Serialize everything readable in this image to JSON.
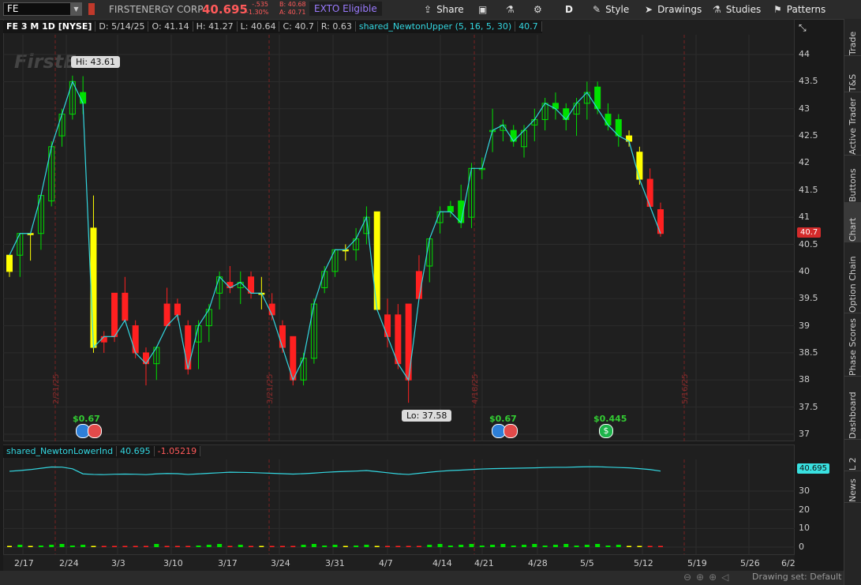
{
  "toolbar": {
    "symbol": "FE",
    "company": "FIRSTENERGY CORP",
    "last": "40.695",
    "change": "-.535",
    "change_pct": "-1.30%",
    "bid": "B: 40.68",
    "ask": "A: 40.71",
    "exto": "EXTO Eligible",
    "share": "Share",
    "aggregation": "D",
    "style": "Style",
    "drawings": "Drawings",
    "studies": "Studies",
    "patterns": "Patterns"
  },
  "infobar": {
    "symbol": "FE 3 M 1D [NYSE]",
    "date": "D: 5/14/25",
    "open": "O: 41.14",
    "high": "H: 41.27",
    "low": "L: 40.64",
    "close": "C: 40.7",
    "range": "R: 0.63",
    "study": "shared_NewtonUpper (5, 16, 5, 30)",
    "study_value": "40.7"
  },
  "lower": {
    "study": "shared_NewtonLowerInd",
    "value": "40.695",
    "value2": "-1.05219",
    "tag": "40.695"
  },
  "price_tag": "40.7",
  "callouts": {
    "hi": "Hi: 43.61",
    "lo": "Lo: 37.58"
  },
  "logo": "FirstE",
  "dividends": [
    "$0.67",
    "$0.67",
    "$0.445"
  ],
  "vlines": [
    "2/21/25",
    "3/21/25",
    "4/18/25",
    "5/16/25"
  ],
  "price_axis": [
    "44",
    "43.5",
    "43",
    "42.5",
    "42",
    "41.5",
    "41",
    "40.5",
    "40",
    "39.5",
    "39",
    "38.5",
    "38",
    "37.5",
    "37"
  ],
  "lower_axis": [
    "30",
    "20",
    "10",
    "0"
  ],
  "x_axis": [
    "2/17",
    "2/24",
    "3/3",
    "3/10",
    "3/17",
    "3/24",
    "3/31",
    "4/7",
    "4/14",
    "4/21",
    "4/28",
    "5/5",
    "5/12",
    "5/19",
    "5/26",
    "6/2"
  ],
  "sidebar": [
    "Trade",
    "T&S",
    "Active Trader",
    "Buttons",
    "Chart",
    "Option Chain",
    "Phase Scores",
    "Dashboard",
    "L 2",
    "News"
  ],
  "drawing_set": "Drawing set: Default",
  "colors": {
    "up": "#00e000",
    "down": "#ff2020",
    "neutral": "#ffff00",
    "line": "#33d6e0",
    "grid": "#2c2c2c",
    "vline": "#7a2020"
  },
  "chart_data": {
    "type": "candlestick",
    "ylim": [
      36.8,
      44.3
    ],
    "candles": [
      [
        "2/14",
        40.0,
        40.3,
        39.9,
        40.3,
        "y"
      ],
      [
        "2/18",
        40.3,
        40.7,
        39.9,
        40.7,
        "g"
      ],
      [
        "2/19",
        40.7,
        40.7,
        40.2,
        40.7,
        "y"
      ],
      [
        "2/20",
        40.7,
        41.4,
        40.4,
        41.4,
        "g"
      ],
      [
        "2/21",
        41.3,
        42.4,
        41.2,
        42.3,
        "g"
      ],
      [
        "2/24",
        42.5,
        43.0,
        42.3,
        42.9,
        "g"
      ],
      [
        "2/25",
        42.9,
        43.61,
        42.8,
        43.5,
        "g"
      ],
      [
        "2/26",
        43.3,
        43.6,
        42.9,
        43.1,
        "g"
      ],
      [
        "2/27",
        40.8,
        41.4,
        38.5,
        38.6,
        "y"
      ],
      [
        "2/28",
        38.7,
        38.9,
        38.5,
        38.8,
        "r"
      ],
      [
        "3/3",
        39.6,
        39.6,
        38.7,
        38.8,
        "r"
      ],
      [
        "3/4",
        39.6,
        39.9,
        39.1,
        39.1,
        "r"
      ],
      [
        "3/5",
        39.0,
        39.1,
        38.4,
        38.5,
        "r"
      ],
      [
        "3/6",
        38.5,
        38.6,
        37.9,
        38.3,
        "r"
      ],
      [
        "3/7",
        38.3,
        38.6,
        38.0,
        38.6,
        "g"
      ],
      [
        "3/10",
        39.4,
        39.7,
        39.0,
        39.0,
        "r"
      ],
      [
        "3/11",
        39.4,
        39.5,
        39.1,
        39.2,
        "r"
      ],
      [
        "3/12",
        39.0,
        39.1,
        38.1,
        38.2,
        "r"
      ],
      [
        "3/13",
        38.7,
        39.1,
        38.2,
        39.0,
        "g"
      ],
      [
        "3/14",
        39.0,
        39.4,
        38.7,
        39.3,
        "g"
      ],
      [
        "3/17",
        39.6,
        40.0,
        39.3,
        39.9,
        "g"
      ],
      [
        "3/18",
        39.8,
        40.1,
        39.6,
        39.7,
        "r"
      ],
      [
        "3/19",
        39.7,
        40.0,
        39.4,
        39.8,
        "g"
      ],
      [
        "3/20",
        39.9,
        40.0,
        39.5,
        39.6,
        "r"
      ],
      [
        "3/21",
        39.6,
        39.9,
        39.3,
        39.6,
        "y"
      ],
      [
        "3/24",
        39.4,
        39.6,
        39.1,
        39.2,
        "r"
      ],
      [
        "3/25",
        39.0,
        39.1,
        38.5,
        38.6,
        "r"
      ],
      [
        "3/26",
        38.8,
        38.8,
        37.9,
        38.0,
        "r"
      ],
      [
        "3/27",
        38.0,
        38.5,
        37.9,
        38.4,
        "g"
      ],
      [
        "3/28",
        38.4,
        39.5,
        38.3,
        39.4,
        "g"
      ],
      [
        "3/31",
        39.7,
        40.1,
        39.6,
        40.0,
        "g"
      ],
      [
        "4/1",
        40.0,
        40.4,
        39.9,
        40.4,
        "g"
      ],
      [
        "4/2",
        40.4,
        40.5,
        40.2,
        40.4,
        "y"
      ],
      [
        "4/3",
        40.4,
        40.8,
        40.2,
        40.6,
        "g"
      ],
      [
        "4/4",
        40.7,
        41.2,
        40.5,
        41.0,
        "g"
      ],
      [
        "4/7",
        41.1,
        41.1,
        39.3,
        39.3,
        "y"
      ],
      [
        "4/8",
        39.2,
        39.5,
        38.6,
        38.8,
        "r"
      ],
      [
        "4/9",
        39.2,
        39.4,
        38.2,
        38.3,
        "r"
      ],
      [
        "4/10",
        39.4,
        39.4,
        37.58,
        38.0,
        "r"
      ],
      [
        "4/11",
        40.0,
        40.3,
        39.5,
        39.5,
        "r"
      ],
      [
        "4/14",
        40.1,
        40.6,
        39.8,
        40.6,
        "g"
      ],
      [
        "4/15",
        40.9,
        41.2,
        40.7,
        41.1,
        "g"
      ],
      [
        "4/16",
        41.2,
        41.3,
        41.0,
        41.1,
        "g"
      ],
      [
        "4/17",
        41.3,
        41.6,
        40.8,
        40.9,
        "g"
      ],
      [
        "4/21",
        41.0,
        42.0,
        40.8,
        41.9,
        "g"
      ],
      [
        "4/22",
        41.9,
        42.1,
        41.7,
        41.9,
        "g"
      ],
      [
        "4/23",
        42.6,
        43.0,
        42.2,
        42.6,
        "g"
      ],
      [
        "4/24",
        42.6,
        42.8,
        42.4,
        42.7,
        "g"
      ],
      [
        "4/25",
        42.6,
        42.7,
        42.3,
        42.4,
        "g"
      ],
      [
        "4/28",
        42.3,
        42.7,
        42.1,
        42.6,
        "g"
      ],
      [
        "4/29",
        42.7,
        43.0,
        42.4,
        42.8,
        "g"
      ],
      [
        "4/30",
        42.8,
        43.2,
        42.6,
        43.1,
        "g"
      ],
      [
        "5/1",
        43.1,
        43.3,
        42.8,
        43.0,
        "g"
      ],
      [
        "5/2",
        43.0,
        43.1,
        42.6,
        42.8,
        "g"
      ],
      [
        "5/5",
        42.9,
        43.2,
        42.5,
        43.1,
        "g"
      ],
      [
        "5/6",
        43.1,
        43.5,
        42.8,
        43.3,
        "g"
      ],
      [
        "5/7",
        43.4,
        43.5,
        42.9,
        43.0,
        "g"
      ],
      [
        "5/8",
        42.9,
        43.1,
        42.6,
        42.7,
        "g"
      ],
      [
        "5/9",
        42.8,
        42.9,
        42.3,
        42.5,
        "g"
      ],
      [
        "5/12",
        42.5,
        42.6,
        42.3,
        42.4,
        "y"
      ],
      [
        "5/13",
        42.2,
        42.3,
        41.6,
        41.7,
        "y"
      ],
      [
        "5/14",
        41.7,
        41.9,
        41.2,
        41.2,
        "r"
      ],
      [
        "5/15",
        41.14,
        41.27,
        40.64,
        40.7,
        "r"
      ]
    ],
    "lower_values": [
      40.6,
      41.0,
      41.5,
      42.2,
      42.9,
      42.8,
      41.9,
      39.2,
      38.9,
      38.8,
      39.0,
      39.1,
      39.0,
      38.8,
      39.2,
      39.4,
      39.3,
      38.9,
      39.2,
      39.5,
      39.8,
      40.1,
      40.0,
      39.9,
      39.7,
      39.5,
      39.3,
      39.1,
      39.3,
      39.6,
      40.0,
      40.3,
      40.5,
      40.7,
      41.0,
      40.4,
      39.8,
      39.2,
      38.9,
      39.5,
      40.1,
      40.6,
      41.0,
      41.2,
      41.5,
      41.8,
      42.0,
      42.1,
      42.2,
      42.3,
      42.4,
      42.6,
      42.7,
      42.7,
      42.9,
      43.0,
      43.0,
      42.8,
      42.6,
      42.4,
      42.0,
      41.5,
      40.695
    ]
  }
}
